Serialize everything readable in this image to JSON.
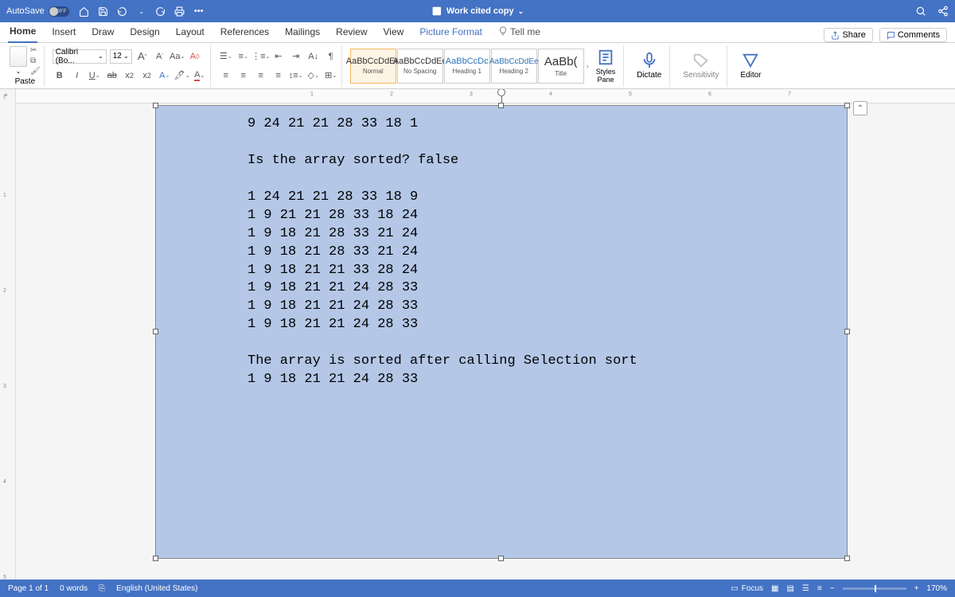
{
  "title_bar": {
    "autosave_label": "AutoSave",
    "autosave_state": "OFF",
    "doc_title": "Work cited copy"
  },
  "tabs": [
    "Home",
    "Insert",
    "Draw",
    "Design",
    "Layout",
    "References",
    "Mailings",
    "Review",
    "View",
    "Picture Format",
    "Tell me"
  ],
  "share": "Share",
  "comments": "Comments",
  "ribbon": {
    "paste": "Paste",
    "font_name": "Calibri (Bo...",
    "font_size": "12",
    "styles": [
      {
        "preview": "AaBbCcDdEe",
        "label": "Normal",
        "cls": ""
      },
      {
        "preview": "AaBbCcDdEe",
        "label": "No Spacing",
        "cls": ""
      },
      {
        "preview": "AaBbCcDc",
        "label": "Heading 1",
        "cls": "h1"
      },
      {
        "preview": "AaBbCcDdEe",
        "label": "Heading 2",
        "cls": "h2"
      },
      {
        "preview": "AaBb(",
        "label": "Title",
        "cls": "title"
      }
    ],
    "styles_pane": "Styles\nPane",
    "dictate": "Dictate",
    "sensitivity": "Sensitivity",
    "editor": "Editor"
  },
  "document_lines": [
    "9 24 21 21 28 33 18 1",
    "",
    "Is the array sorted? false",
    "",
    "1 24 21 21 28 33 18 9",
    "1 9 21 21 28 33 18 24",
    "1 9 18 21 28 33 21 24",
    "1 9 18 21 28 33 21 24",
    "1 9 18 21 21 33 28 24",
    "1 9 18 21 21 24 28 33",
    "1 9 18 21 21 24 28 33",
    "1 9 18 21 21 24 28 33",
    "",
    "The array is sorted after calling Selection sort",
    "1 9 18 21 21 24 28 33"
  ],
  "status": {
    "page": "Page 1 of 1",
    "words": "0 words",
    "lang": "English (United States)",
    "focus": "Focus",
    "zoom": "170%"
  },
  "hruler_nums": [
    "1",
    "2",
    "3",
    "4",
    "5",
    "6",
    "7"
  ],
  "vruler_nums": [
    "1",
    "2",
    "3",
    "4",
    "5"
  ]
}
